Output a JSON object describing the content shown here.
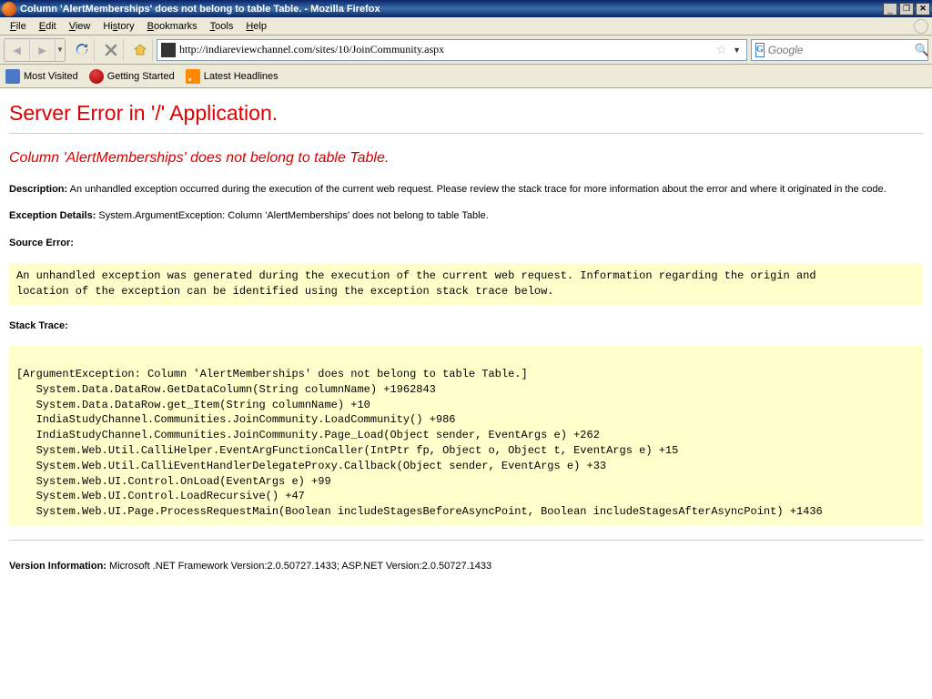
{
  "window": {
    "title": "Column 'AlertMemberships' does not belong to table Table. - Mozilla Firefox",
    "minimize": "_",
    "restore": "❐",
    "close": "✕"
  },
  "menu": {
    "file": "File",
    "edit": "Edit",
    "view": "View",
    "history": "History",
    "bookmarks": "Bookmarks",
    "tools": "Tools",
    "help": "Help"
  },
  "nav": {
    "url": "http://indiareviewchannel.com/sites/10/JoinCommunity.aspx",
    "search_placeholder": "Google"
  },
  "bookmarks": {
    "most_visited": "Most Visited",
    "getting_started": "Getting Started",
    "latest_headlines": "Latest Headlines"
  },
  "page": {
    "h1": "Server Error in '/' Application.",
    "h2": "Column 'AlertMemberships' does not belong to table Table.",
    "desc_label": "Description:",
    "desc_text": " An unhandled exception occurred during the execution of the current web request. Please review the stack trace for more information about the error and where it originated in the code.",
    "exc_label": "Exception Details:",
    "exc_text": " System.ArgumentException: Column 'AlertMemberships' does not belong to table Table.",
    "src_label": "Source Error:",
    "src_box": "An unhandled exception was generated during the execution of the current web request. Information regarding the origin and\nlocation of the exception can be identified using the exception stack trace below.",
    "stack_label": "Stack Trace:",
    "stack_box": "\n[ArgumentException: Column 'AlertMemberships' does not belong to table Table.]\n   System.Data.DataRow.GetDataColumn(String columnName) +1962843\n   System.Data.DataRow.get_Item(String columnName) +10\n   IndiaStudyChannel.Communities.JoinCommunity.LoadCommunity() +986\n   IndiaStudyChannel.Communities.JoinCommunity.Page_Load(Object sender, EventArgs e) +262\n   System.Web.Util.CalliHelper.EventArgFunctionCaller(IntPtr fp, Object o, Object t, EventArgs e) +15\n   System.Web.Util.CalliEventHandlerDelegateProxy.Callback(Object sender, EventArgs e) +33\n   System.Web.UI.Control.OnLoad(EventArgs e) +99\n   System.Web.UI.Control.LoadRecursive() +47\n   System.Web.UI.Page.ProcessRequestMain(Boolean includeStagesBeforeAsyncPoint, Boolean includeStagesAfterAsyncPoint) +1436\n",
    "ver_label": "Version Information:",
    "ver_text": " Microsoft .NET Framework Version:2.0.50727.1433; ASP.NET Version:2.0.50727.1433"
  }
}
